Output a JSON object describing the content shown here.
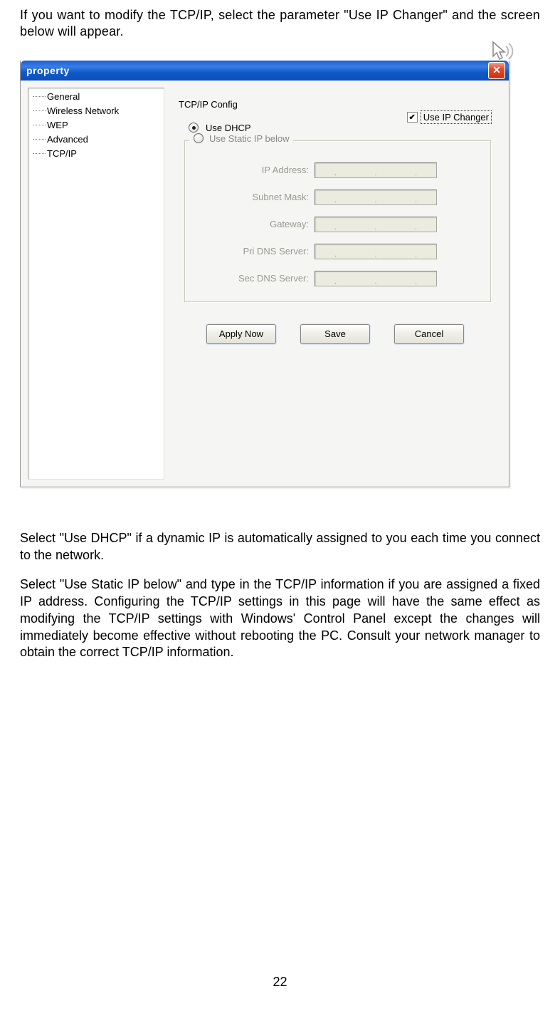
{
  "doc": {
    "intro": "If you want to modify the TCP/IP, select the parameter \"Use IP Changer\" and the screen below will appear.",
    "para1": "Select \"Use DHCP\" if a dynamic IP is automatically assigned to you each time you connect to the network.",
    "para2": "Select \"Use Static IP below\" and type in the TCP/IP information if you are assigned a fixed IP address. Configuring the TCP/IP settings in this page will have the same effect as modifying the TCP/IP settings with Windows' Control Panel except the changes will immediately become effective without rebooting the PC. Consult your network manager to obtain the correct TCP/IP information.",
    "page_number": "22"
  },
  "dialog": {
    "title": "property",
    "sidebar_items": [
      "General",
      "Wireless Network",
      "WEP",
      "Advanced",
      "TCP/IP"
    ],
    "section_title": "TCP/IP Config",
    "use_ip_changer_label": "Use IP Changer",
    "use_ip_changer_checked": true,
    "radio_dhcp_label": "Use DHCP",
    "radio_dhcp_selected": true,
    "radio_static_label": "Use Static IP below",
    "fields": [
      {
        "label": "IP Address:"
      },
      {
        "label": "Subnet Mask:"
      },
      {
        "label": "Gateway:"
      },
      {
        "label": "Pri DNS Server:"
      },
      {
        "label": "Sec DNS Server:"
      }
    ],
    "buttons": {
      "apply": "Apply Now",
      "save": "Save",
      "cancel": "Cancel"
    }
  }
}
